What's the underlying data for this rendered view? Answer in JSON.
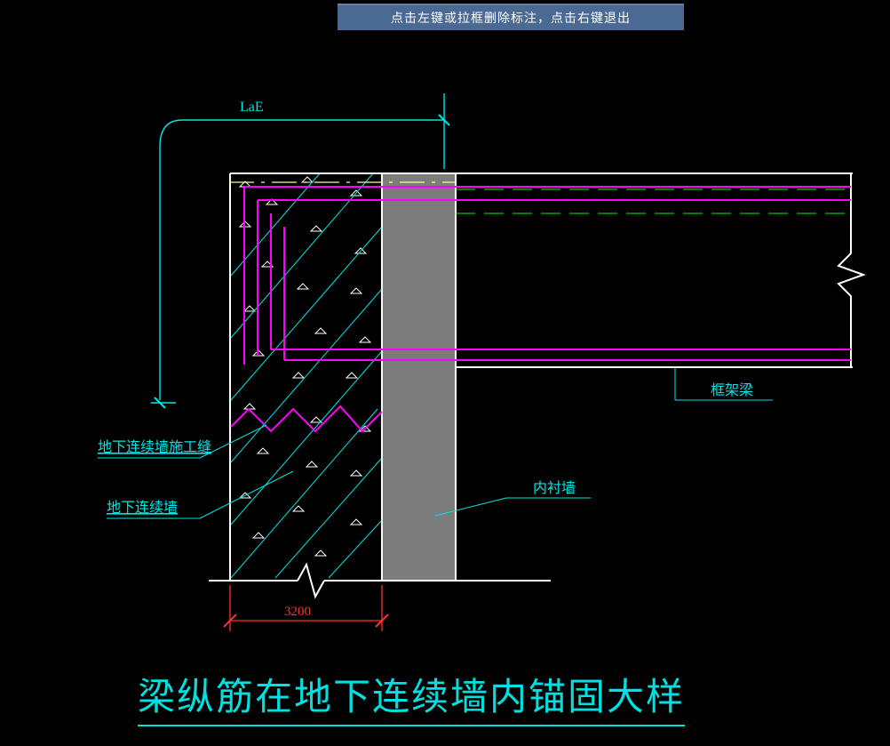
{
  "tooltip_text": "点击左键或拉框删除标注，点击右键退出",
  "labels": {
    "lae": "LaE",
    "joint": "地下连续墙施工缝",
    "wall": "地下连续墙",
    "inner_wall": "内衬墙",
    "beam": "框架梁",
    "dimension": "3200"
  },
  "title": "梁纵筋在地下连续墙内锚固大样",
  "chart_data": {
    "type": "diagram",
    "description": "CAD construction detail: anchorage of beam longitudinal reinforcement into diaphragm (underground continuous) wall",
    "dimension_mm": 3200,
    "components": [
      {
        "name": "地下连续墙",
        "en": "Diaphragm wall"
      },
      {
        "name": "地下连续墙施工缝",
        "en": "Diaphragm wall construction joint"
      },
      {
        "name": "内衬墙",
        "en": "Inner lining wall"
      },
      {
        "name": "框架梁",
        "en": "Frame beam"
      }
    ],
    "rebar_anchor_label": "LaE"
  }
}
